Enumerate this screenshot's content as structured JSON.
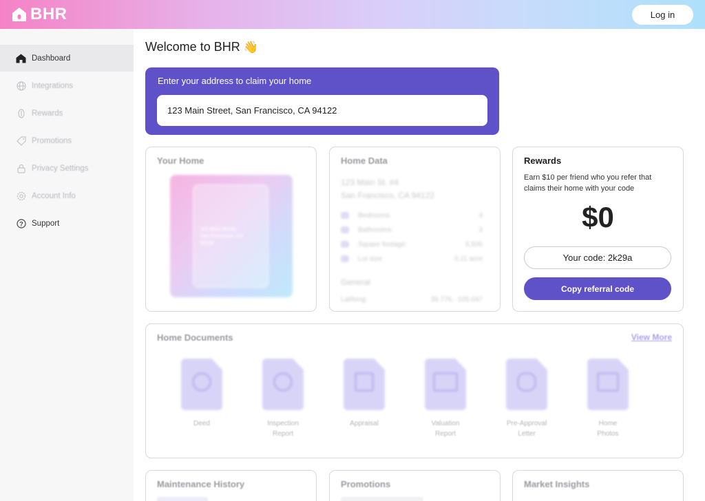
{
  "header": {
    "logo_text": "BHR",
    "login_label": "Log in"
  },
  "sidebar": {
    "items": [
      {
        "label": "Dashboard",
        "icon": "house-icon"
      },
      {
        "label": "Integrations",
        "icon": "globe-icon"
      },
      {
        "label": "Rewards",
        "icon": "coin-icon"
      },
      {
        "label": "Promotions",
        "icon": "tag-icon"
      },
      {
        "label": "Privacy Settings",
        "icon": "lock-icon"
      },
      {
        "label": "Account Info",
        "icon": "gear-icon"
      },
      {
        "label": "Support",
        "icon": "question-icon"
      }
    ]
  },
  "main": {
    "welcome": "Welcome to BHR",
    "welcome_emoji": "👋",
    "claim": {
      "title": "Enter your address to claim your home",
      "address_value": "123 Main Street, San Francisco, CA 94122"
    }
  },
  "your_home": {
    "title": "Your Home",
    "illus_line1": "123 Main Street,",
    "illus_line2": "San Francisco, CA",
    "illus_line3": "94122"
  },
  "home_data": {
    "title": "Home Data",
    "address_line1": "123 Main St. #4",
    "address_line2": "San Francisco, CA 94122",
    "rows": [
      {
        "label": "Bedrooms:",
        "value": "4"
      },
      {
        "label": "Bathrooms:",
        "value": "3"
      },
      {
        "label": "Square footage:",
        "value": "5,500"
      },
      {
        "label": "Lot size:",
        "value": "0.11 acre"
      }
    ],
    "general_title": "General",
    "latlong_label": "Lat/long:",
    "latlong_value": "39.776, -105.047"
  },
  "rewards": {
    "title": "Rewards",
    "description": "Earn $10 per friend who you refer that claims their home with your code",
    "amount": "$0",
    "code_text": "Your code: 2k29a",
    "copy_label": "Copy referral code"
  },
  "documents": {
    "title": "Home Documents",
    "view_more": "View More",
    "items": [
      {
        "line1": "Deed",
        "line2": "",
        "icon": "ribbon-icon"
      },
      {
        "line1": "Inspection",
        "line2": "Report",
        "icon": "magnifier-icon"
      },
      {
        "line1": "Appraisal",
        "line2": "",
        "icon": "clipboard-icon"
      },
      {
        "line1": "Valuation",
        "line2": "Report",
        "icon": "banknote-icon"
      },
      {
        "line1": "Pre-Approval",
        "line2": "Letter",
        "icon": "handshake-icon"
      },
      {
        "line1": "Home",
        "line2": "Photos",
        "icon": "photo-icon"
      }
    ]
  },
  "bottom_cards": {
    "maintenance": "Maintenance History",
    "promotions": "Promotions",
    "market": "Market Insights"
  },
  "colors": {
    "accent": "#5f52c9",
    "sidebar_bg": "#f7f7f8",
    "active_nav_bg": "#e9e9ec"
  }
}
